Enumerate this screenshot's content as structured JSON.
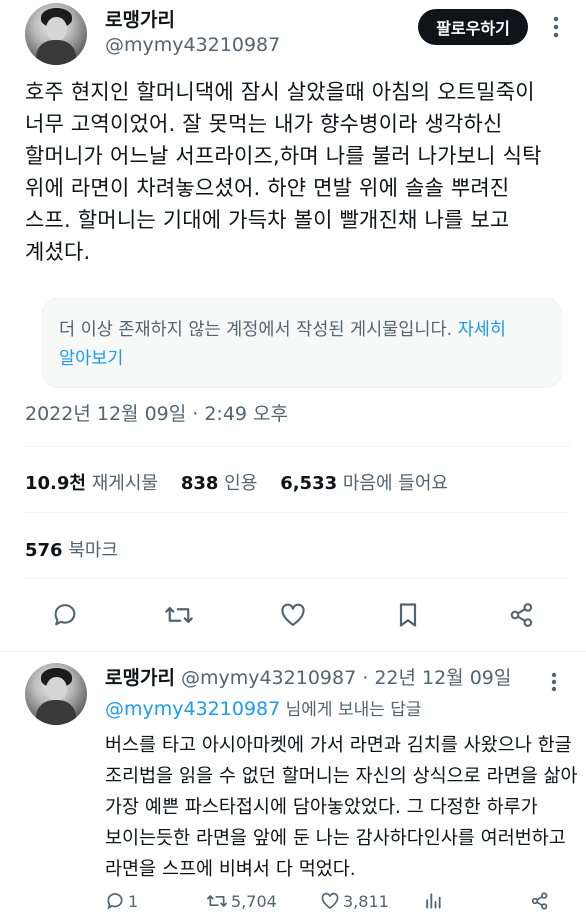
{
  "tweet": {
    "display_name": "로맹가리",
    "handle": "@mymy43210987",
    "follow_label": "팔로우하기",
    "text_lines": [
      "호주 현지인 할머니댁에 잠시 살았을때 아침의 오트밀죽이",
      "너무 고역이었어. 잘 못먹는 내가 향수병이라 생각하신",
      "할머니가 어느날 서프라이즈,하며 나를 불러 나가보니 식탁",
      "위에 라면이 차려놓으셨어. 하얀 면발 위에 솔솔 뿌려진",
      "스프. 할머니는 기대에 가득차 볼이 빨개진채 나를 보고",
      "계셨다."
    ],
    "notice_text": "더 이상 존재하지 않는 계정에서 작성된 게시물입니다. ",
    "notice_link_a": "자세히",
    "notice_link_b": "알아보기",
    "timestamp": "2022년 12월 09일 · 2:49 오후",
    "stats": {
      "retweets_count": "10.9천",
      "retweets_label": "재게시물",
      "quotes_count": "838",
      "quotes_label": "인용",
      "likes_count": "6,533",
      "likes_label": "마음에 들어요",
      "bookmarks_count": "576",
      "bookmarks_label": "북마크"
    }
  },
  "reply": {
    "display_name": "로맹가리",
    "handle": "@mymy43210987",
    "date": "· 22년 12월 09일",
    "reply_to_handle": "@mymy43210987",
    "reply_to_suffix": " 님에게 보내는 답글",
    "text_lines": [
      "버스를 타고 아시아마켓에 가서 라면과 김치를 사왔으나 한글",
      "조리법을 읽을 수 없던 할머니는 자신의 상식으로 라면을 삶아",
      "가장 예쁜 파스타접시에 담아놓았었다. 그 다정한 하루가",
      "보이는듯한 라면을 앞에 둔 나는 감사하다인사를 여러번하고",
      "라면을 스프에 비벼서 다 먹었다."
    ],
    "actions": {
      "replies": "1",
      "retweets": "5,704",
      "likes": "3,811"
    }
  },
  "colors": {
    "text": "#0f1419",
    "muted": "#536471",
    "link": "#1d9bf0",
    "divider": "#eff3f4"
  },
  "icons": [
    "more-icon",
    "reply-icon",
    "retweet-icon",
    "like-icon",
    "bookmark-icon",
    "share-icon",
    "views-icon"
  ]
}
